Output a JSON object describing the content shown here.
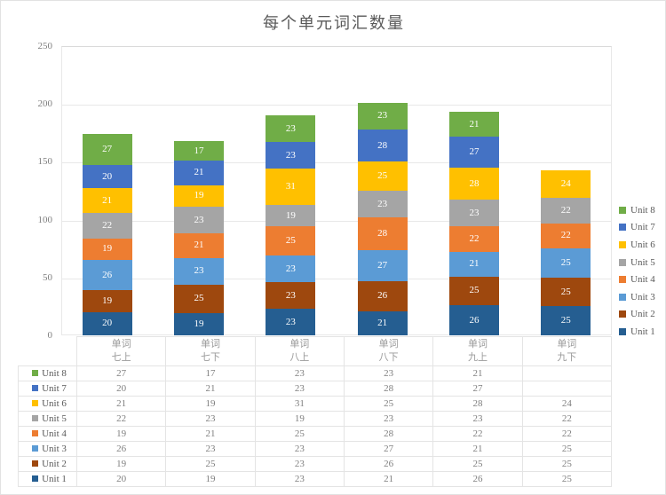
{
  "chart_data": {
    "type": "bar",
    "subtype": "stacked-column",
    "title": "每个单元词汇数量",
    "xlabel": "",
    "ylabel": "",
    "ylim": [
      0,
      250
    ],
    "yticks": [
      0,
      50,
      100,
      150,
      200,
      250
    ],
    "grid": true,
    "legend_position": "right",
    "data_labels": true,
    "categories": [
      {
        "line1": "单词",
        "line2": "七上"
      },
      {
        "line1": "单词",
        "line2": "七下"
      },
      {
        "line1": "单词",
        "line2": "八上"
      },
      {
        "line1": "单词",
        "line2": "八下"
      },
      {
        "line1": "单词",
        "line2": "九上"
      },
      {
        "line1": "单词",
        "line2": "九下"
      }
    ],
    "category_labels": [
      "单词 七上",
      "单词 七下",
      "单词 八上",
      "单词 八下",
      "单词 九上",
      "单词 九下"
    ],
    "series": [
      {
        "name": "Unit 1",
        "color": "#255E91",
        "values": [
          20,
          19,
          23,
          21,
          26,
          25
        ]
      },
      {
        "name": "Unit 2",
        "color": "#9E480E",
        "values": [
          19,
          25,
          23,
          26,
          25,
          25
        ]
      },
      {
        "name": "Unit 3",
        "color": "#5B9BD5",
        "values": [
          26,
          23,
          23,
          27,
          21,
          25
        ]
      },
      {
        "name": "Unit 4",
        "color": "#ED7D31",
        "values": [
          19,
          21,
          25,
          28,
          22,
          22
        ]
      },
      {
        "name": "Unit 5",
        "color": "#A5A5A5",
        "values": [
          22,
          23,
          19,
          23,
          23,
          22
        ]
      },
      {
        "name": "Unit 6",
        "color": "#FFC000",
        "values": [
          21,
          19,
          31,
          25,
          28,
          24
        ]
      },
      {
        "name": "Unit 7",
        "color": "#4472C4",
        "values": [
          20,
          21,
          23,
          28,
          27,
          null
        ]
      },
      {
        "name": "Unit 8",
        "color": "#70AD47",
        "values": [
          27,
          17,
          23,
          23,
          21,
          null
        ]
      }
    ],
    "legend_order": [
      "Unit 8",
      "Unit 7",
      "Unit 6",
      "Unit 5",
      "Unit 4",
      "Unit 3",
      "Unit 2",
      "Unit 1"
    ],
    "totals": [
      174,
      168,
      190,
      201,
      193,
      143
    ]
  },
  "table": {
    "row_order": [
      "Unit 8",
      "Unit 7",
      "Unit 6",
      "Unit 5",
      "Unit 4",
      "Unit 3",
      "Unit 2",
      "Unit 1"
    ]
  }
}
